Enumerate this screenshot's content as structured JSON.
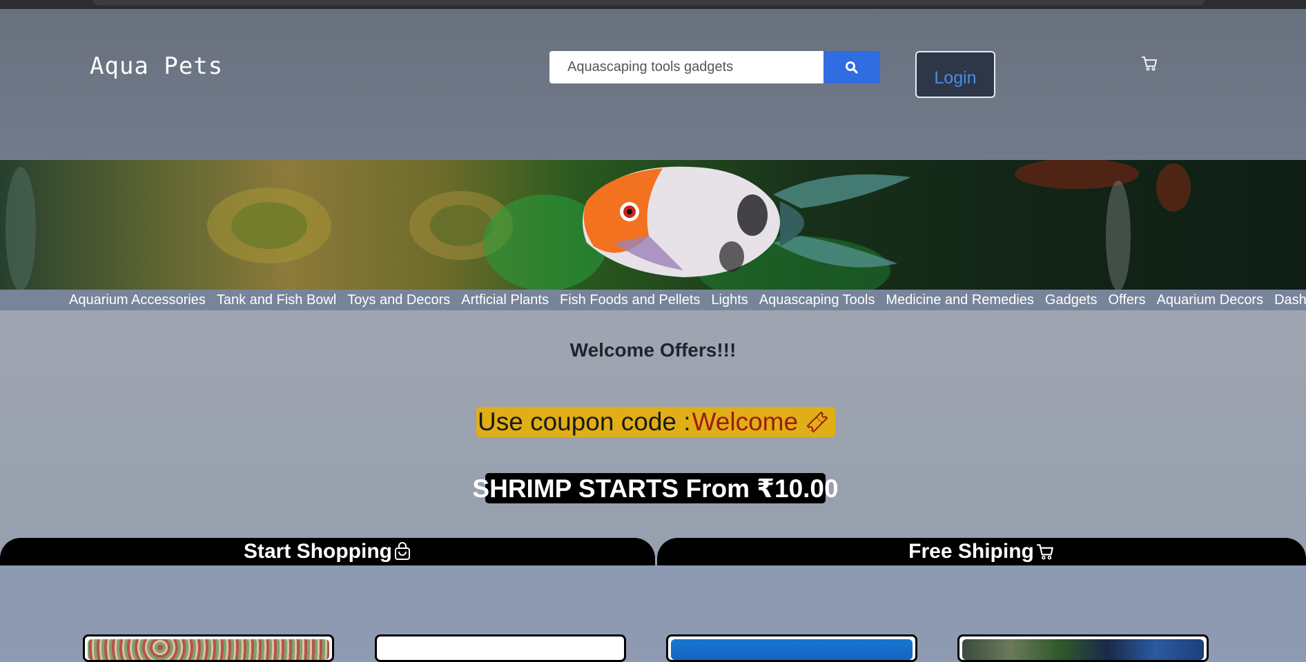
{
  "header": {
    "brand": "Aqua Pets",
    "search": {
      "value": "Aquascaping tools gadgets",
      "button_icon": "search-icon"
    },
    "login_label": "Login",
    "cart_icon": "cart-icon"
  },
  "banner": {
    "alt": "Angelfish banner"
  },
  "nav": {
    "items": [
      "Aquarium Accessories",
      "Tank and Fish Bowl",
      "Toys and Decors",
      "Artficial Plants",
      "Fish Foods and Pellets",
      "Lights",
      "Aquascaping Tools",
      "Medicine and Remedies",
      "Gadgets",
      "Offers",
      "Aquarium Decors",
      "Dashboard"
    ]
  },
  "offers": {
    "title": "Welcome Offers!!!",
    "coupon_prefix": "Use coupon code :",
    "coupon_code": "Welcome",
    "shrimp_text": "SHRIMP STARTS From ₹10.00"
  },
  "features": {
    "start_shopping": "Start Shopping",
    "free_shipping": "Free Shiping"
  },
  "colors": {
    "header_bg": "#6b7381",
    "accent_blue": "#2f6de0",
    "coupon_bg": "#e0ae17",
    "coupon_code": "#9b1c12"
  }
}
